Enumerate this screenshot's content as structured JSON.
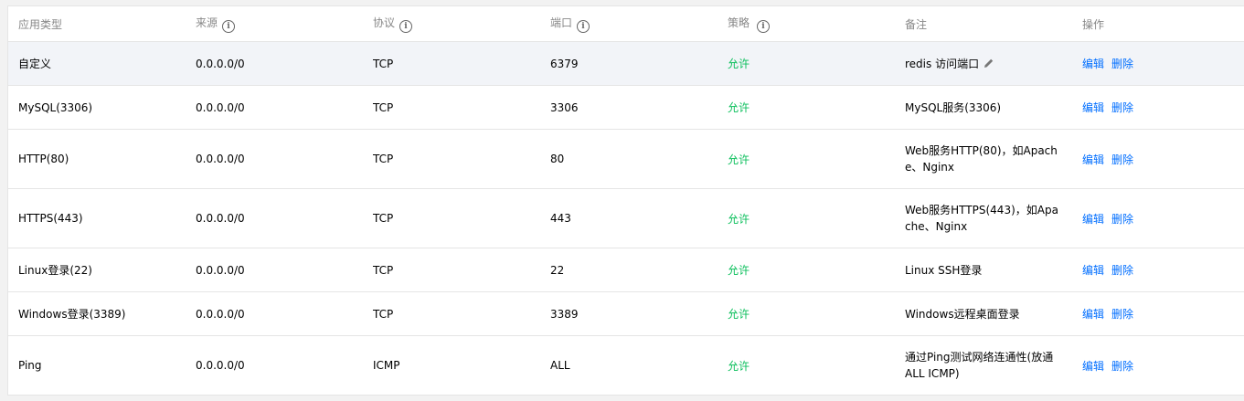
{
  "header": {
    "app_type": "应用类型",
    "source": "来源",
    "protocol": "协议",
    "port": "端口",
    "policy": "策略",
    "note": "备注",
    "actions": "操作"
  },
  "rows": [
    {
      "app_type": "自定义",
      "source": "0.0.0.0/0",
      "protocol": "TCP",
      "port": "6379",
      "policy": "允许",
      "note": "redis 访问端口",
      "edit": "编辑",
      "delete": "删除"
    },
    {
      "app_type": "MySQL(3306)",
      "source": "0.0.0.0/0",
      "protocol": "TCP",
      "port": "3306",
      "policy": "允许",
      "note": "MySQL服务(3306)",
      "edit": "编辑",
      "delete": "删除"
    },
    {
      "app_type": "HTTP(80)",
      "source": "0.0.0.0/0",
      "protocol": "TCP",
      "port": "80",
      "policy": "允许",
      "note": "Web服务HTTP(80)，如Apache、Nginx",
      "edit": "编辑",
      "delete": "删除"
    },
    {
      "app_type": "HTTPS(443)",
      "source": "0.0.0.0/0",
      "protocol": "TCP",
      "port": "443",
      "policy": "允许",
      "note": "Web服务HTTPS(443)，如Apache、Nginx",
      "edit": "编辑",
      "delete": "删除"
    },
    {
      "app_type": "Linux登录(22)",
      "source": "0.0.0.0/0",
      "protocol": "TCP",
      "port": "22",
      "policy": "允许",
      "note": "Linux SSH登录",
      "edit": "编辑",
      "delete": "删除"
    },
    {
      "app_type": "Windows登录(3389)",
      "source": "0.0.0.0/0",
      "protocol": "TCP",
      "port": "3389",
      "policy": "允许",
      "note": "Windows远程桌面登录",
      "edit": "编辑",
      "delete": "删除"
    },
    {
      "app_type": "Ping",
      "source": "0.0.0.0/0",
      "protocol": "ICMP",
      "port": "ALL",
      "policy": "允许",
      "note": "通过Ping测试网络连通性(放通ALL ICMP)",
      "edit": "编辑",
      "delete": "删除"
    }
  ],
  "icons": {
    "info": "info-circle-icon",
    "edit": "pencil-icon"
  },
  "colors": {
    "allow": "#0abf5b",
    "link": "#006eff",
    "header_text": "#888888",
    "highlight_row": "#f2f4f8"
  }
}
